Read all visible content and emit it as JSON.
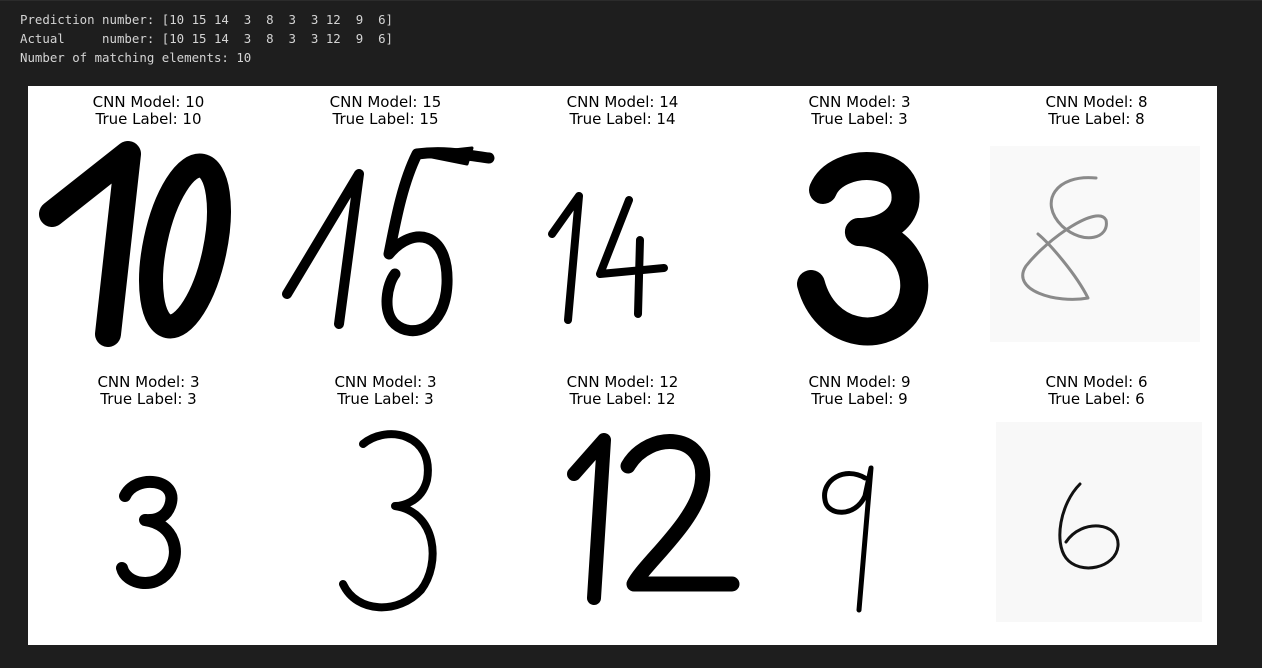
{
  "console": {
    "prediction_line": "Prediction number: [10 15 14  3  8  3  3 12  9  6]",
    "actual_line": "Actual     number: [10 15 14  3  8  3  3 12  9  6]",
    "matching_line": "Number of matching elements: 10"
  },
  "figure": {
    "panels": [
      {
        "model": "CNN Model: 10",
        "label": "True Label: 10",
        "digit": "10"
      },
      {
        "model": "CNN Model: 15",
        "label": "True Label: 15",
        "digit": "15"
      },
      {
        "model": "CNN Model: 14",
        "label": "True Label: 14",
        "digit": "14"
      },
      {
        "model": "CNN Model: 3",
        "label": "True Label: 3",
        "digit": "3"
      },
      {
        "model": "CNN Model: 8",
        "label": "True Label: 8",
        "digit": "8"
      },
      {
        "model": "CNN Model: 3",
        "label": "True Label: 3",
        "digit": "3"
      },
      {
        "model": "CNN Model: 3",
        "label": "True Label: 3",
        "digit": "3"
      },
      {
        "model": "CNN Model: 12",
        "label": "True Label: 12",
        "digit": "12"
      },
      {
        "model": "CNN Model: 9",
        "label": "True Label: 9",
        "digit": "9"
      },
      {
        "model": "CNN Model: 6",
        "label": "True Label: 6",
        "digit": "6"
      }
    ]
  }
}
